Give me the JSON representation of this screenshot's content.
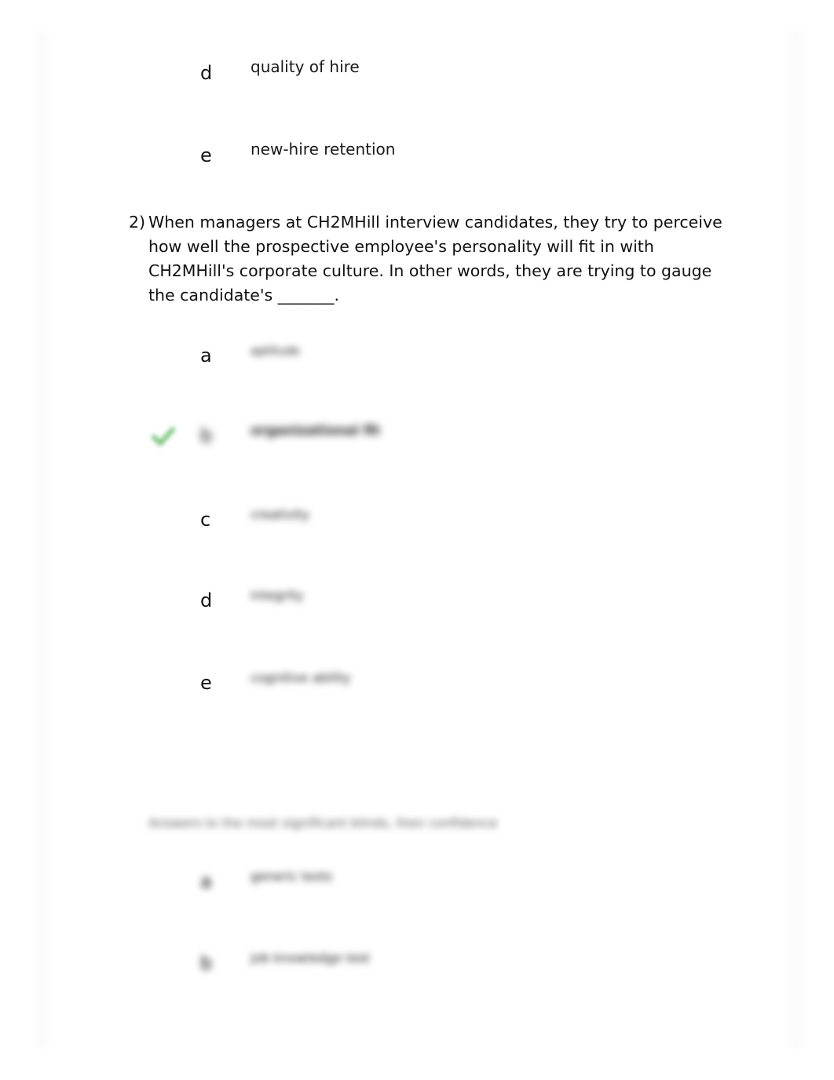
{
  "question1_tail": {
    "options": [
      {
        "letter": "d",
        "text": "quality of hire"
      },
      {
        "letter": "e",
        "text": "new-hire retention"
      }
    ]
  },
  "question2": {
    "number": "2)",
    "text": "When managers at CH2MHill interview candidates, they try to perceive how well the prospective employee's personality will fit in with CH2MHill's corporate culture. In other words, they are trying to gauge the candidate's _______.",
    "options": [
      {
        "letter": "a",
        "text": "aptitude",
        "obscured": true
      },
      {
        "letter": "b",
        "text": "organizational fit",
        "obscured": true,
        "marked_correct": true
      },
      {
        "letter": "c",
        "text": "creativity",
        "obscured": true
      },
      {
        "letter": "d",
        "text": "integrity",
        "obscured": true
      },
      {
        "letter": "e",
        "text": "cognitive ability",
        "obscured": true
      }
    ],
    "correct_mark_color": "#4caf50"
  },
  "question3": {
    "text": "Answers to the most significant blinds, then confidence",
    "obscured": true,
    "options": [
      {
        "letter": "a",
        "text": "generic tests",
        "obscured": true
      },
      {
        "letter": "b",
        "text": "job knowledge test",
        "obscured": true
      }
    ]
  }
}
